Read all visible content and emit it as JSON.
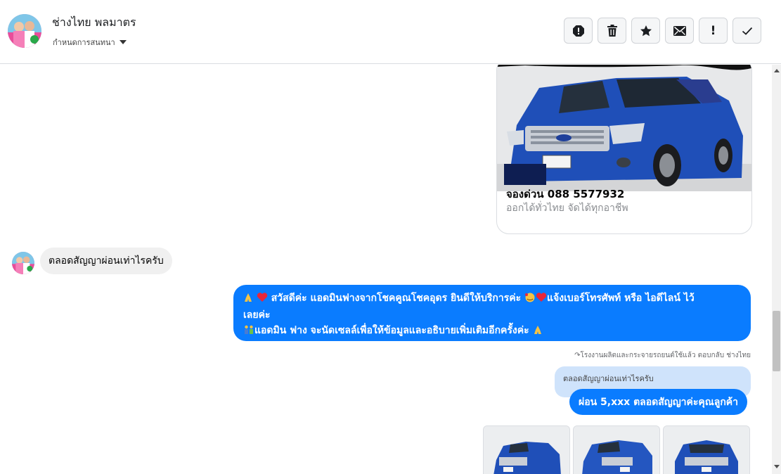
{
  "header": {
    "contact_name": "ช่างไทย พลมาตร",
    "conversation_setting": "กำหนดการสนทนา",
    "actions": [
      {
        "name": "report-icon",
        "label": "!"
      },
      {
        "name": "trash-icon"
      },
      {
        "name": "star-icon"
      },
      {
        "name": "mail-icon"
      },
      {
        "name": "mark-important-icon",
        "label": "!"
      },
      {
        "name": "check-icon"
      }
    ]
  },
  "card": {
    "title": "จองด่วน 088 5577932",
    "subtitle": "ออกได้ทั่วไทย จัดได้ทุกอาชีพ",
    "car_color": "#1f4fb8"
  },
  "messages": {
    "incoming_1": "ตลอดสัญญาผ่อนเท่าไรครับ",
    "outgoing_1_line1": "สวัสดีค่ะ แอดมินฟางจากโชคคูณโชคอุดร ยินดีให้บริการค่ะ",
    "outgoing_1_line1b": "แจ้งเบอร์โทรศัพท์ หรือ ไอดีไลน์  ไว้",
    "outgoing_1_line2": "เลยค่ะ",
    "outgoing_1_line3": "แอดมิน ฟาง จะนัดเซลล์เพื่อให้ข้อมูลและอธิบายเพิ่มเติมอีกครั้งค่ะ",
    "reply_meta": "โรงงานผลิตและกระจายรถยนต์ใช้แล้ว ตอบกลับ ช่างไทย",
    "quoted": "ตลอดสัญญาผ่อนเท่าไรครับ",
    "outgoing_2": "ผ่อน 5,xxx ตลอดสัญญาค่ะคุณลูกค้า"
  },
  "colors": {
    "bubble_outgoing": "#0a7cff",
    "bubble_incoming": "#f0f0f0",
    "quoted_bg": "#cfe3fb"
  }
}
